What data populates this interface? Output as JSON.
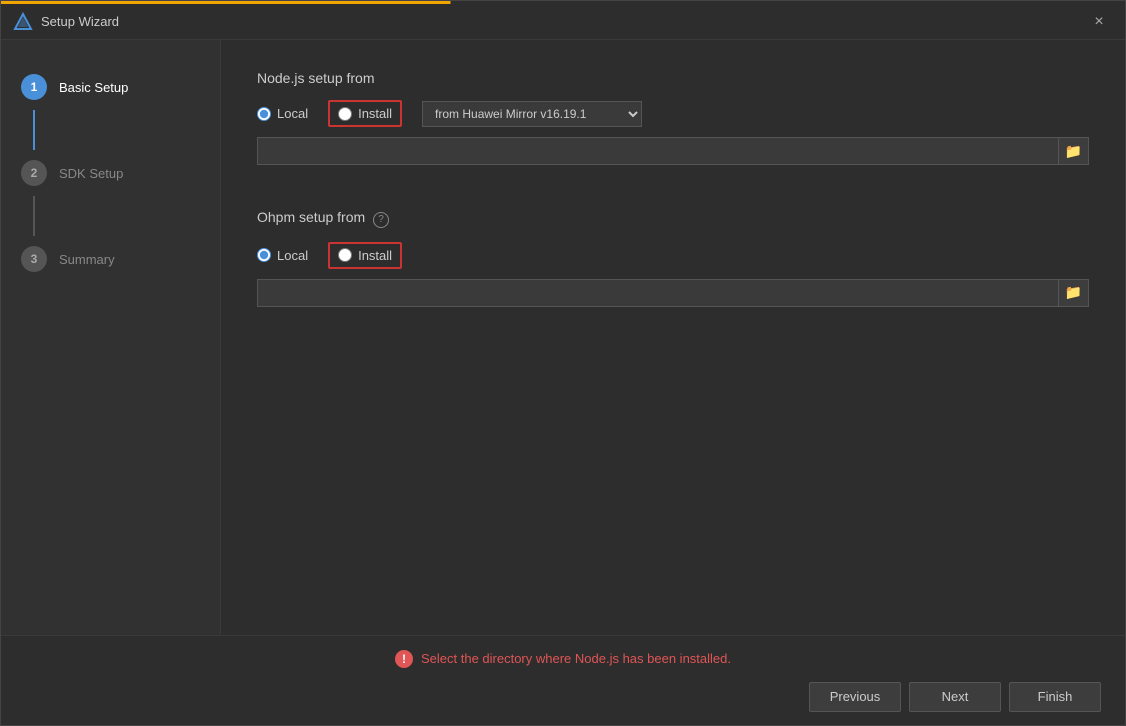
{
  "window": {
    "title": "Setup Wizard",
    "close_label": "×"
  },
  "top_progress": {},
  "sidebar": {
    "steps": [
      {
        "number": "1",
        "label": "Basic Setup",
        "state": "active",
        "connector": "active"
      },
      {
        "number": "2",
        "label": "SDK Setup",
        "state": "inactive",
        "connector": "inactive"
      },
      {
        "number": "3",
        "label": "Summary",
        "state": "inactive",
        "connector": null
      }
    ]
  },
  "main": {
    "nodejs_section_title": "Node.js setup from",
    "nodejs_local_label": "Local",
    "nodejs_install_label": "Install",
    "nodejs_mirror_option": "from Huawei Mirror v16.19.1",
    "nodejs_path_placeholder": "",
    "ohpm_section_title": "Ohpm setup from",
    "ohpm_help_tooltip": "?",
    "ohpm_local_label": "Local",
    "ohpm_install_label": "Install",
    "ohpm_path_placeholder": ""
  },
  "bottom": {
    "error_message": "Select the directory where Node.js has been installed.",
    "previous_label": "Previous",
    "next_label": "Next",
    "finish_label": "Finish"
  },
  "icons": {
    "folder": "📁",
    "app_icon": "△",
    "error_icon": "!"
  }
}
